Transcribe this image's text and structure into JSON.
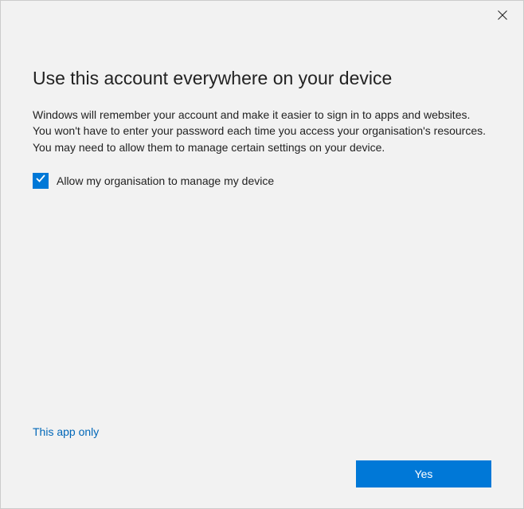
{
  "dialog": {
    "title": "Use this account everywhere on your device",
    "description": "Windows will remember your account and make it easier to sign in to apps and websites. You won't have to enter your password each time you access your organisation's resources. You may need to allow them to manage certain settings on your device.",
    "checkbox": {
      "checked": true,
      "label": "Allow my organisation to manage my device"
    },
    "link": "This app only",
    "primary_button": "Yes"
  }
}
